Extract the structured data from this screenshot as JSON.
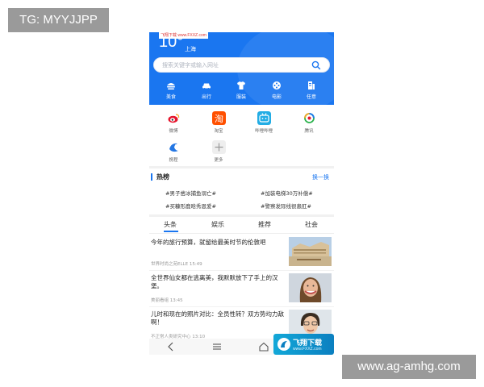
{
  "overlay": {
    "tag_label": "TG: MYYJJPP",
    "watermark_url": "www.ag-amhg.com"
  },
  "header": {
    "logo_badge": "飞翔下载 www.FXXZ.com",
    "temperature": "10°",
    "city": "上海",
    "search_placeholder": "搜索关键字或输入网址",
    "categories": [
      {
        "label": "美食",
        "icon": "food-icon"
      },
      {
        "label": "出行",
        "icon": "car-icon"
      },
      {
        "label": "服装",
        "icon": "shirt-icon"
      },
      {
        "label": "电影",
        "icon": "film-icon"
      },
      {
        "label": "任意",
        "icon": "document-icon"
      }
    ]
  },
  "apps": [
    {
      "label": "微博",
      "icon": "weibo-icon",
      "color": "#fbe8d4"
    },
    {
      "label": "淘宝",
      "icon": "taobao-icon",
      "color": "#ff5000"
    },
    {
      "label": "哔哩哔哩",
      "icon": "bilibili-icon",
      "color": "#23ade5"
    },
    {
      "label": "腾讯",
      "icon": "tencent-icon",
      "color": "#ffffff"
    },
    {
      "label": "携程",
      "icon": "ctrip-icon",
      "color": "#ffffff"
    },
    {
      "label": "更多",
      "icon": "plus-icon",
      "color": "#eeeeee"
    }
  ],
  "hot": {
    "title": "热榜",
    "more": "换一换",
    "items": [
      "#男子凿冰捕鱼溺亡#",
      "#加装电梯30万补偿#",
      "#买糠形鹿晗秀恩爱#",
      "#警察发际线很患肛#"
    ]
  },
  "tabs": [
    "头条",
    "娱乐",
    "推荐",
    "社会"
  ],
  "news": [
    {
      "title": "今年的旅行预算，就留给最美时节的伦敦吧",
      "meta": "世界时尚之苑ELLE  15:49",
      "thumb": "london-building-image"
    },
    {
      "title": "全世界仙女都在逃离美，我默默放下了手上的汉堡。",
      "meta": "美丽看组  13:45",
      "thumb": "woman-portrait-image"
    },
    {
      "title": "儿时和现在的照片对比：全员性转？双方势均力敌啊！",
      "meta": "不正常人类研究中心  13:10",
      "thumb": "child-portrait-image"
    }
  ],
  "corner_logo": {
    "text": "飞翔下载",
    "sub": "www.FXXZ.com"
  },
  "colors": {
    "brand_blue": "#1a76f0",
    "tab_active": "#1a76f0"
  }
}
